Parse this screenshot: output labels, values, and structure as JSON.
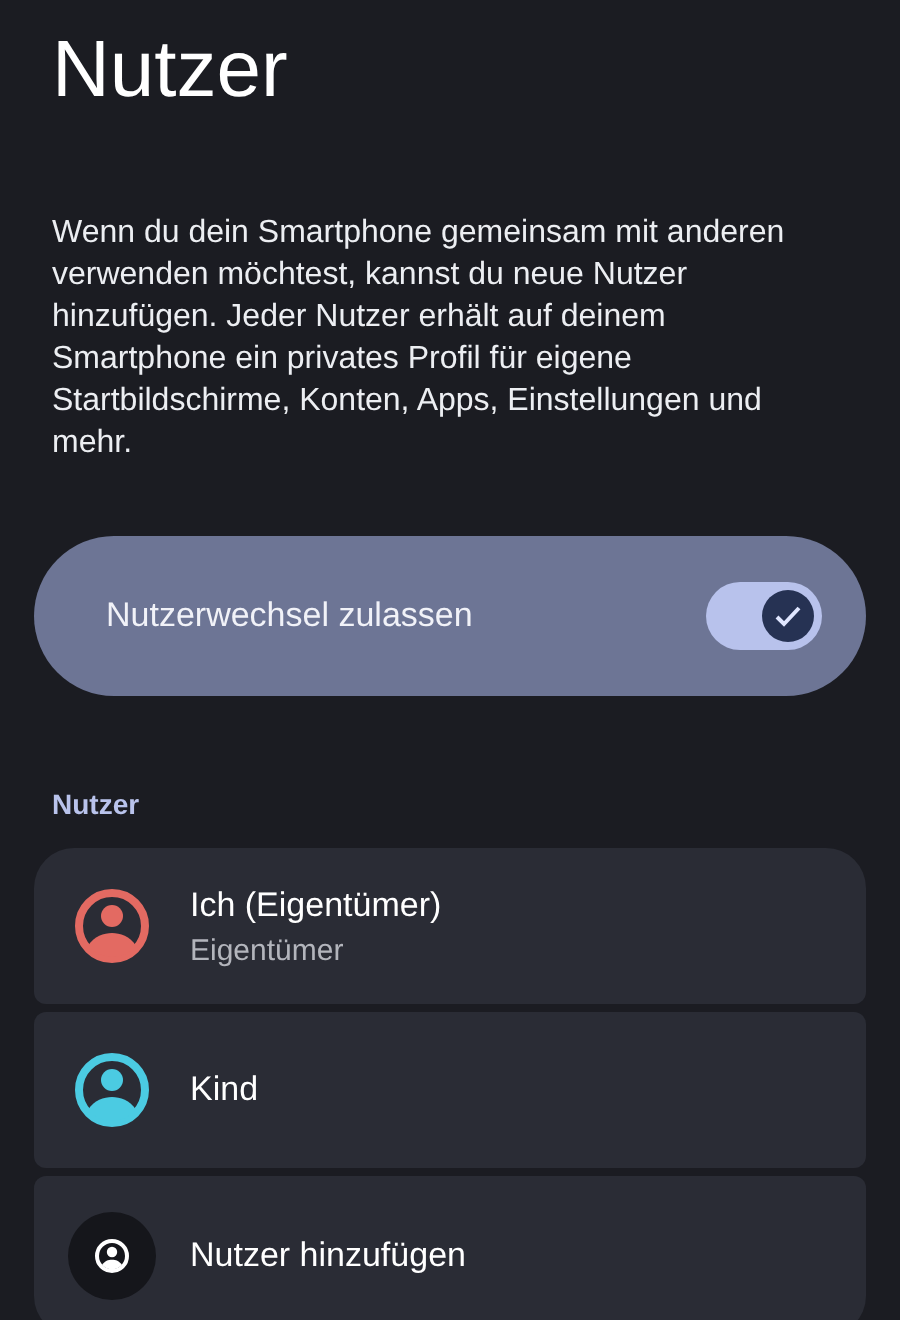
{
  "title": "Nutzer",
  "description": "Wenn du dein Smartphone gemeinsam mit anderen verwenden möchtest, kannst du neue Nutzer hinzufügen. Jeder Nutzer erhält auf deinem Smartphone ein privates Profil für eigene Startbildschirme, Konten, Apps, Einstellungen und mehr.",
  "switch_card": {
    "label": "Nutzerwechsel zulassen",
    "on": true
  },
  "section": {
    "title": "Nutzer",
    "items": [
      {
        "kind": "user",
        "name": "Ich (Eigentümer)",
        "subtitle": "Eigentümer",
        "color": "#e36a62"
      },
      {
        "kind": "user",
        "name": "Kind",
        "color": "#4bcbe2"
      },
      {
        "kind": "add",
        "name": "Nutzer hinzufügen"
      }
    ]
  }
}
